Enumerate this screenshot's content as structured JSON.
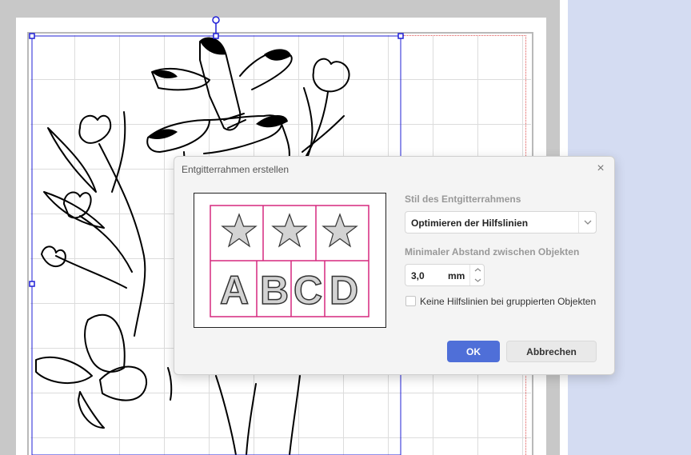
{
  "dialog": {
    "title": "Entgitterrahmen erstellen",
    "close_label": "×",
    "style_label": "Stil des Entgitterrahmens",
    "style_value": "Optimieren der Hilfslinien",
    "distance_label": "Minimaler Abstand zwischen Objekten",
    "distance_value": "3,0",
    "distance_unit": "mm",
    "checkbox_label": "Keine Hilfslinien bei gruppierten Objekten",
    "checkbox_checked": false,
    "ok_label": "OK",
    "cancel_label": "Abbrechen"
  },
  "preview": {
    "letters": [
      "A",
      "B",
      "C",
      "D"
    ],
    "star_count": 3,
    "frame_color": "#d6287f"
  },
  "colors": {
    "accent": "#4f6fd8",
    "selection": "#1f1fd6",
    "background": "#d4dcf2"
  }
}
